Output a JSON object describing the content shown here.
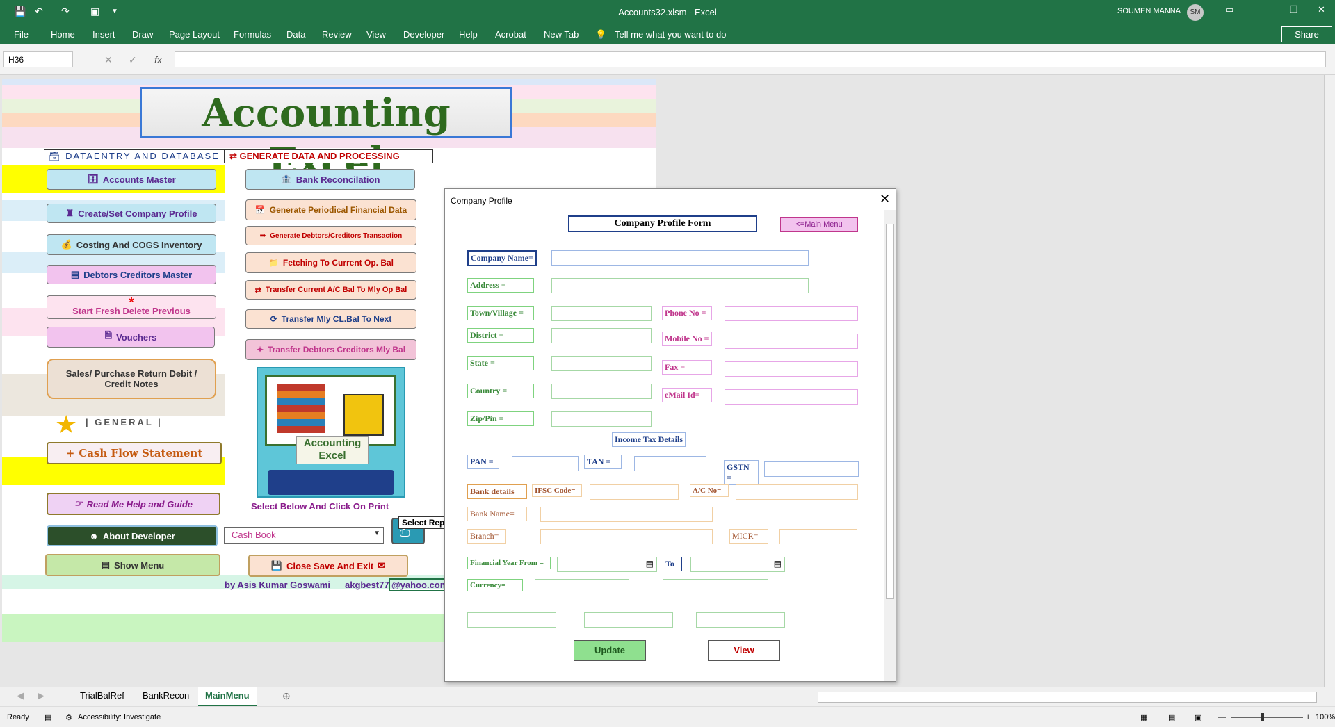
{
  "window": {
    "title": "Accounts32.xlsm - Excel",
    "user": "SOUMEN MANNA",
    "user_initials": "SM"
  },
  "ribbon": {
    "tabs": [
      "File",
      "Home",
      "Insert",
      "Draw",
      "Page Layout",
      "Formulas",
      "Data",
      "Review",
      "View",
      "Developer",
      "Help",
      "Acrobat",
      "New Tab"
    ],
    "tell_me": "Tell me what you want to do",
    "share": "Share"
  },
  "formula_bar": {
    "name_box": "H36",
    "fx": "fx",
    "value": ""
  },
  "main_menu": {
    "logo_text": "Accounting Excel",
    "section_data": "DATAENTRY AND DATABASE",
    "section_generate": "GENERATE DATA AND PROCESSING",
    "section_general": "|   GENERAL   |",
    "left_buttons": [
      "Accounts Master",
      "Create/Set Company Profile",
      "Costing And COGS Inventory",
      "Debtors Creditors Master",
      "Start Fresh Delete Previous",
      "Vouchers",
      "Sales/ Purchase Return Debit / Credit Notes",
      "Cash Flow Statement",
      "Read Me Help and Guide",
      "About Developer",
      "Show Menu"
    ],
    "middle_buttons": [
      "Bank Reconcilation",
      "Generate Periodical Financial Data",
      "Generate Debtors/Creditors Transaction",
      "Fetching  To Current Op. Bal",
      "Transfer Current A/C Bal  To Mly Op Bal",
      "Transfer Mly  CL.Bal To Next",
      "Transfer Debtors Creditors Mly Bal"
    ],
    "book_caption": "Accounting Excel",
    "select_prompt": "Select Below And Click On Print",
    "report_select": "Cash Book",
    "select_report_tip": "Select Rep",
    "close_save": "Close Save And Exit",
    "author": "by Asis Kumar Goswami",
    "email_a": "akgbest77",
    "email_b": "@yahoo.com"
  },
  "dialog": {
    "title": "Company Profile",
    "form_title": "Company Profile Form",
    "main_menu": "<=Main Menu",
    "labels": {
      "company_name": "Company Name=",
      "address": "Address        =",
      "town": "Town/Village   =",
      "district": "District         =",
      "state": "State            =",
      "country": "Country         =",
      "zip": "Zip/Pin         =",
      "phone": "Phone No  =",
      "mobile": "Mobile No =",
      "fax": "Fax  =",
      "email": "eMail Id=",
      "income_tax": "Income Tax Details",
      "pan": "PAN =",
      "tan": "TAN  =",
      "gstn": "GSTN =",
      "bank_details": "Bank details",
      "ifsc": "IFSC Code=",
      "acno": "A/C No=",
      "bank_name": "Bank Name=",
      "branch": "Branch=",
      "micr": "MICR=",
      "fy_from": "Financial Year From =",
      "to": "To",
      "currency": "Currency="
    },
    "update": "Update",
    "view": "View"
  },
  "sheet_tabs": [
    "TrialBalRef",
    "BankRecon",
    "MainMenu"
  ],
  "active_tab": "MainMenu",
  "status": {
    "ready": "Ready",
    "accessibility": "Accessibility: Investigate",
    "zoom": "100%"
  }
}
